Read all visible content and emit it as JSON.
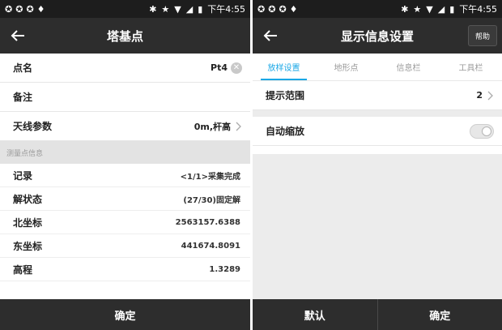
{
  "left": {
    "status": {
      "time": "下午4:55"
    },
    "title": "塔基点",
    "fields": [
      {
        "label": "点名",
        "value": "Pt4"
      },
      {
        "label": "备注",
        "value": ""
      },
      {
        "label": "天线参数",
        "value": "0m,杆高"
      }
    ],
    "section_header": "测量点信息",
    "details": [
      {
        "label": "记录",
        "value": "<1/1>采集完成"
      },
      {
        "label": "解状态",
        "value": "(27/30)固定解"
      },
      {
        "label": "北坐标",
        "value": "2563157.6388"
      },
      {
        "label": "东坐标",
        "value": "441674.8091"
      },
      {
        "label": "高程",
        "value": "1.3289"
      }
    ],
    "confirm_label": "确定"
  },
  "right": {
    "status": {
      "time": "下午4:55"
    },
    "title": "显示信息设置",
    "help_label": "帮助",
    "tabs": [
      "放样设置",
      "地形点",
      "信息栏",
      "工具栏"
    ],
    "active_tab": 0,
    "hint_range": {
      "label": "提示范围",
      "value": "2"
    },
    "auto_zoom": {
      "label": "自动缩放",
      "enabled": false
    },
    "default_label": "默认",
    "confirm_label": "确定"
  },
  "colors": {
    "accent": "#1aa7e6",
    "bar": "#2d2d2d",
    "status": "#1d1d1d"
  }
}
